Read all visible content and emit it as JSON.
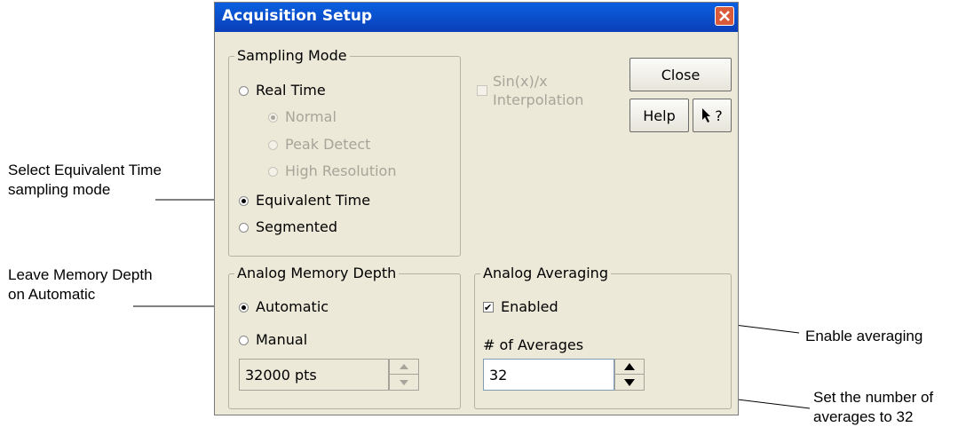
{
  "dialog": {
    "title": "Acquisition Setup"
  },
  "sampling_mode": {
    "label": "Sampling Mode",
    "options": [
      {
        "label": "Real Time",
        "selected": false,
        "enabled": true
      },
      {
        "label": "Normal",
        "selected": true,
        "enabled": false
      },
      {
        "label": "Peak Detect",
        "selected": false,
        "enabled": false
      },
      {
        "label": "High Resolution",
        "selected": false,
        "enabled": false
      },
      {
        "label": "Equivalent Time",
        "selected": true,
        "enabled": true
      },
      {
        "label": "Segmented",
        "selected": false,
        "enabled": true
      }
    ]
  },
  "interpolation": {
    "line1": "Sin(x)/x",
    "line2": "Interpolation",
    "checked": false,
    "enabled": false
  },
  "buttons": {
    "close": "Close",
    "help": "Help",
    "whats_this": "?"
  },
  "memory_depth": {
    "label": "Analog Memory Depth",
    "automatic": "Automatic",
    "manual": "Manual",
    "automatic_selected": true,
    "value": "32000 pts"
  },
  "averaging": {
    "label": "Analog Averaging",
    "enabled_label": "Enabled",
    "enabled_checked": true,
    "count_label": "# of Averages",
    "count_value": "32"
  },
  "annotations": {
    "select_equiv_1": "Select Equivalent Time",
    "select_equiv_2": "sampling mode",
    "memory_1": "Leave Memory Depth",
    "memory_2": "on Automatic",
    "enable_avg": "Enable averaging",
    "set_num_1": "Set the number of",
    "set_num_2": "averages to 32"
  },
  "colors": {
    "titlebar": "#0a4fd0",
    "dialog_bg": "#ece9d8",
    "close_x": "#d95b3a"
  }
}
